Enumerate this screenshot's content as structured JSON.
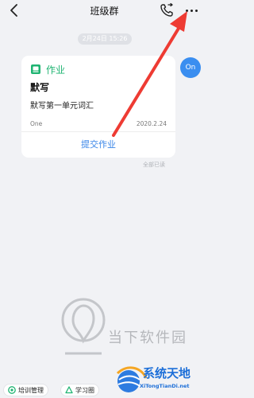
{
  "header": {
    "title": "班级群",
    "icons": [
      "back-arrow-icon",
      "phone-call-icon",
      "more-dots-icon"
    ]
  },
  "chat": {
    "timestamp": "2月24日 15:26",
    "avatar_text": "On",
    "card": {
      "type_label": "作业",
      "type_icon": "book-icon",
      "title": "默写",
      "description": "默写第一单元词汇",
      "author": "One",
      "date": "2020.2.24",
      "action_label": "提交作业"
    },
    "read_status": "全部已读"
  },
  "bottom_tools": [
    {
      "label": "培训管理",
      "icon": "training-icon"
    },
    {
      "label": "学习圈",
      "icon": "study-circle-icon"
    }
  ],
  "watermark": {
    "text": "当下软件园",
    "brand_name": "系统天地",
    "brand_url": "XiTongTianDi.net"
  },
  "colors": {
    "accent_blue": "#3a86e8",
    "green": "#1fb472",
    "arrow_red": "#ee3b33",
    "background": "#f1f2f5"
  }
}
